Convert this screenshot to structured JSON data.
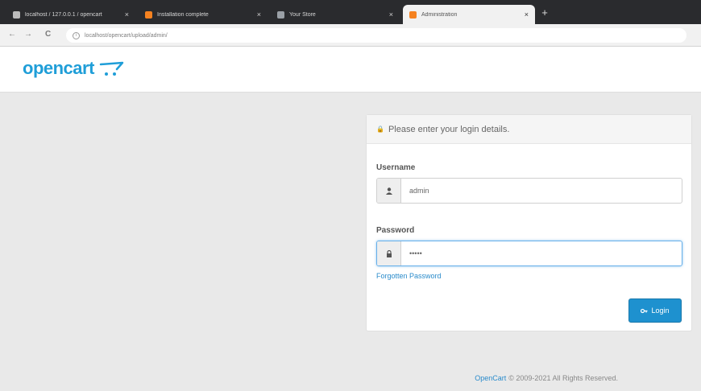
{
  "browser": {
    "tabs": [
      {
        "title": "localhost / 127.0.0.1 / opencart",
        "close": "×",
        "favicon_color": "#bcbcbc"
      },
      {
        "title": "Installation complete",
        "close": "×",
        "favicon_color": "#f58220"
      },
      {
        "title": "Your Store",
        "close": "×",
        "favicon_color": "#9aa0a6"
      },
      {
        "title": "Administration",
        "close": "×",
        "favicon_color": "#f58220"
      }
    ],
    "new_tab": "+",
    "nav": {
      "back": "←",
      "forward": "→",
      "reload": "C"
    },
    "url": "localhost/opencart/upload/admin/"
  },
  "header": {
    "logo_text": "opencart"
  },
  "login": {
    "heading": "Please enter your login details.",
    "username_label": "Username",
    "username_value": "admin",
    "password_label": "Password",
    "password_value": "•••••",
    "forgotten": "Forgotten Password",
    "login_button": "Login"
  },
  "footer": {
    "brand": "OpenCart",
    "text": "© 2009-2021 All Rights Reserved."
  },
  "colors": {
    "accent": "#1e91cf",
    "logo": "#1f9ed8",
    "tabbar": "#2a2b2e"
  }
}
